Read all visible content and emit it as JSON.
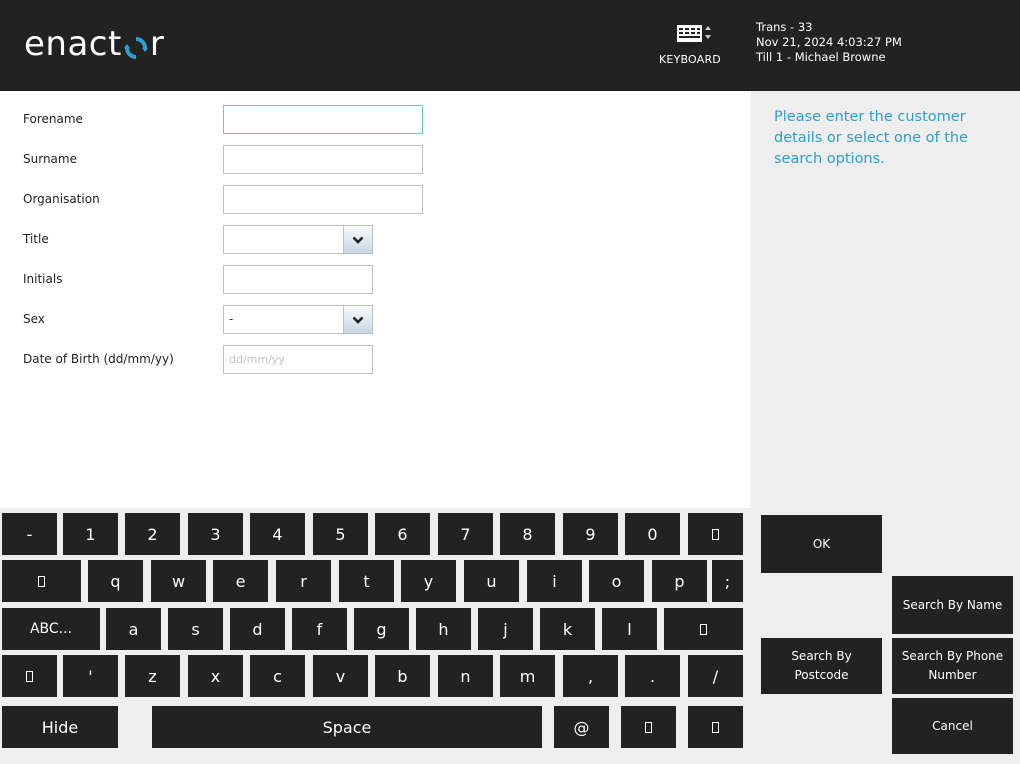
{
  "header": {
    "logo_text_pre": "enact",
    "logo_text_post": "r",
    "brand_color": "#2a9fd6",
    "keyboard_label": "KEYBOARD",
    "trans": "Trans - 33",
    "datetime": "Nov 21, 2024 4:03:27 PM",
    "till": "Till 1 - Michael Browne"
  },
  "form": {
    "fields": [
      {
        "label": "Forename",
        "value": "",
        "type": "text",
        "focused": true
      },
      {
        "label": "Surname",
        "value": "",
        "type": "text"
      },
      {
        "label": "Organisation",
        "value": "",
        "type": "text"
      },
      {
        "label": "Title",
        "value": "",
        "type": "select"
      },
      {
        "label": "Initials",
        "value": "",
        "type": "text"
      },
      {
        "label": "Sex",
        "value": "-",
        "type": "select"
      },
      {
        "label": "Date of Birth (dd/mm/yy)",
        "value": "",
        "placeholder": "dd/mm/yy",
        "type": "text"
      }
    ]
  },
  "side": {
    "prompt": "Please enter the customer details or select one of the search options.",
    "prompt_color": "#2aa0cc"
  },
  "keyboard": {
    "row1": [
      "-",
      "1",
      "2",
      "3",
      "4",
      "5",
      "6",
      "7",
      "8",
      "9",
      "0",
      "backspace"
    ],
    "row2": [
      "tab",
      "q",
      "w",
      "e",
      "r",
      "t",
      "y",
      "u",
      "i",
      "o",
      "p",
      ";"
    ],
    "row3": [
      "ABC...",
      "a",
      "s",
      "d",
      "f",
      "g",
      "h",
      "j",
      "k",
      "l",
      "enter"
    ],
    "row4": [
      "shift",
      "'",
      "z",
      "x",
      "c",
      "v",
      "b",
      "n",
      "m",
      ",",
      ".",
      "/"
    ],
    "row5": [
      "Hide",
      "Space",
      "@",
      "left-arrow",
      "right-arrow"
    ]
  },
  "actions": {
    "ok": "OK",
    "search_name": "Search By Name",
    "search_postcode": "Search By Postcode",
    "search_phone": "Search By Phone Number",
    "cancel": "Cancel"
  }
}
